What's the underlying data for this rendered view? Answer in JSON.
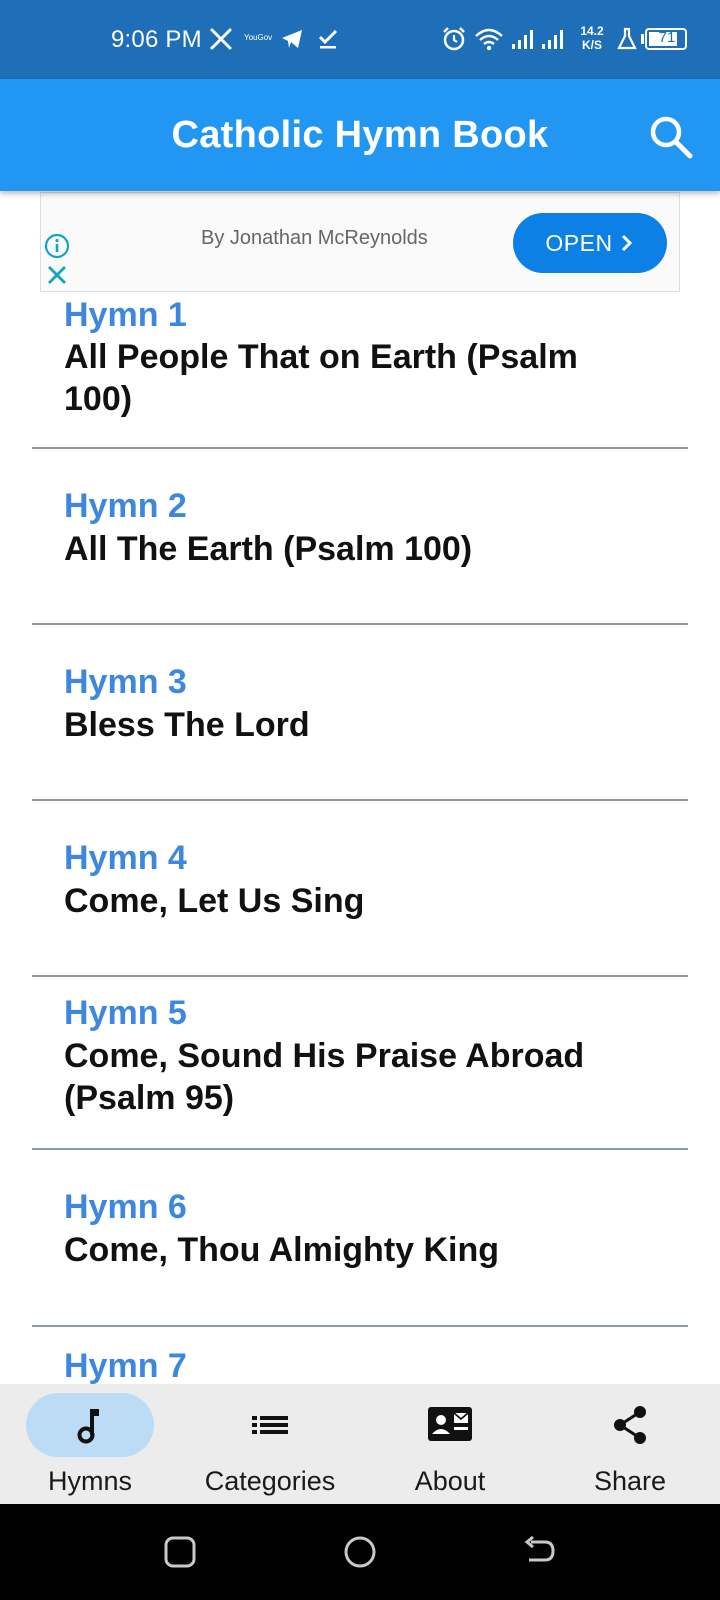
{
  "status_bar": {
    "time": "9:06 PM",
    "notif_icons": [
      "x-logo-icon",
      "yougov-icon",
      "telegram-icon",
      "check-icon"
    ],
    "yougov_text": "YouGov",
    "net_speed_value": "14.2",
    "net_speed_unit": "K/S",
    "battery": "71",
    "bg_color": "#1e6fb8"
  },
  "app_bar": {
    "title": "Catholic Hymn Book",
    "search_icon": "search-icon",
    "bg_color": "#2196f3"
  },
  "ad": {
    "text": "By Jonathan McReynolds",
    "button_label": "OPEN",
    "button_color": "#0d80e6"
  },
  "hymns": [
    {
      "number": "Hymn 1",
      "title": "All People That on Earth (Psalm 100)"
    },
    {
      "number": "Hymn 2",
      "title": "All The Earth (Psalm 100)"
    },
    {
      "number": "Hymn 3",
      "title": "Bless The Lord"
    },
    {
      "number": "Hymn 4",
      "title": "Come, Let Us Sing"
    },
    {
      "number": "Hymn 5",
      "title": "Come, Sound His Praise Abroad (Psalm 95)"
    },
    {
      "number": "Hymn 6",
      "title": "Come, Thou Almighty King"
    },
    {
      "number": "Hymn 7",
      "title": ""
    }
  ],
  "hymn_number_color": "#3d87e0",
  "bottom_nav": {
    "items": [
      {
        "label": "Hymns",
        "icon": "music-note-icon",
        "selected": true
      },
      {
        "label": "Categories",
        "icon": "list-icon",
        "selected": false
      },
      {
        "label": "About",
        "icon": "contact-card-icon",
        "selected": false
      },
      {
        "label": "Share",
        "icon": "share-icon",
        "selected": false
      }
    ],
    "selected_pill_color": "#bcdcf6"
  },
  "system_nav": {
    "buttons": [
      "recents-icon",
      "home-icon",
      "back-icon"
    ]
  }
}
